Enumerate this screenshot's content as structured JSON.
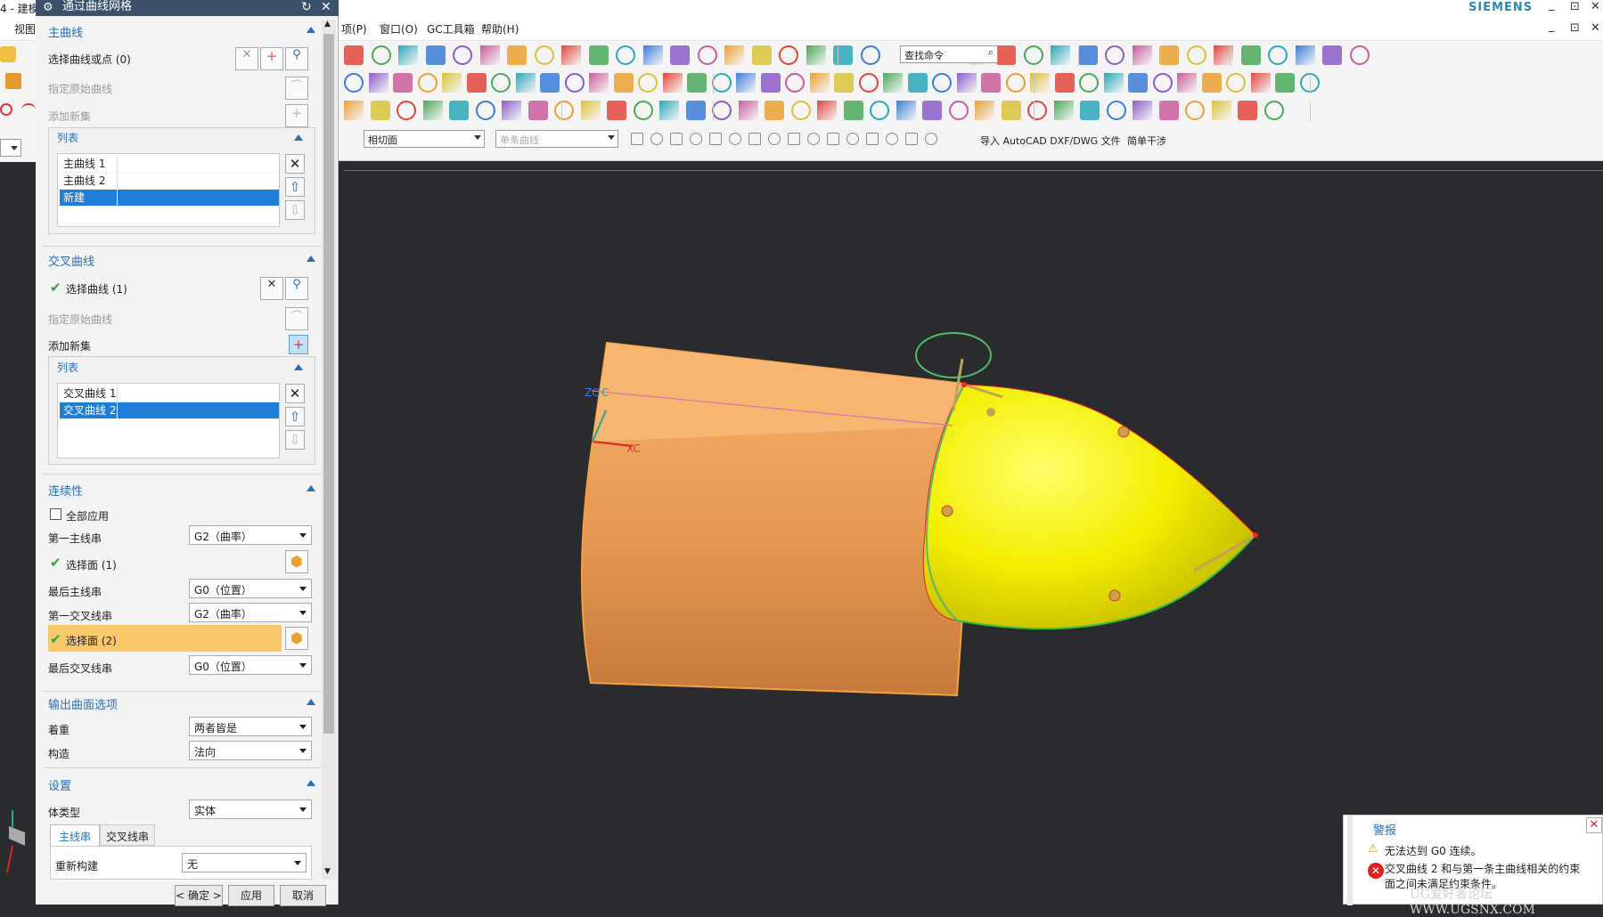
{
  "app": {
    "title_fragment": "4 - 建模",
    "brand": "SIEMENS",
    "menus": [
      "视图",
      "项(P)",
      "窗口(O)",
      "GC工具箱",
      "帮助(H)"
    ],
    "window_controls": [
      "_",
      "⊡",
      "✕"
    ]
  },
  "dialog": {
    "title": "通过曲线网格",
    "primary": {
      "header": "主曲线",
      "select_label": "选择曲线或点 (0)",
      "specify_origin": "指定原始曲线",
      "add_new_set": "添加新集",
      "list_header": "列表",
      "items": [
        "主曲线 1",
        "主曲线 2",
        "新建"
      ]
    },
    "cross": {
      "header": "交叉曲线",
      "select_label": "选择曲线 (1)",
      "specify_origin": "指定原始曲线",
      "add_new_set": "添加新集",
      "list_header": "列表",
      "items": [
        "交叉曲线 1",
        "交叉曲线 2"
      ]
    },
    "continuity": {
      "header": "连续性",
      "apply_all": "全部应用",
      "first_primary": "第一主线串",
      "first_primary_val": "G2（曲率）",
      "select_face_1": "选择面 (1)",
      "last_primary": "最后主线串",
      "last_primary_val": "G0（位置）",
      "first_cross": "第一交叉线串",
      "first_cross_val": "G2（曲率）",
      "select_face_2": "选择面 (2)",
      "last_cross": "最后交叉线串",
      "last_cross_val": "G0（位置）"
    },
    "output": {
      "header": "输出曲面选项",
      "emphasis": "着重",
      "emphasis_val": "两者皆是",
      "construction": "构造",
      "construction_val": "法向"
    },
    "settings": {
      "header": "设置",
      "body_type": "体类型",
      "body_type_val": "实体",
      "tab_primary": "主线串",
      "tab_cross": "交叉线串",
      "rebuild": "重新构建",
      "rebuild_val": "无"
    },
    "buttons": {
      "ok": "< 确定 >",
      "apply": "应用",
      "cancel": "取消"
    }
  },
  "toolbar": {
    "search_placeholder": "查找命令",
    "snap_combo": "相切面",
    "curve_combo": "单条曲线",
    "import_label": "导入 AutoCAD DXF/DWG 文件",
    "simple_label": "简单干涉"
  },
  "viewport": {
    "axis_zc": "ZC",
    "axis_xc": "XC",
    "axis_yc": "C"
  },
  "alert": {
    "title": "警报",
    "msg1": "无法达到 G0 连续。",
    "msg2": "交叉曲线 2 和与第一条主曲线相关的约束面之间未满足约束条件。"
  },
  "watermark": "UG爱好者论坛 WWW.UGSNX.COM",
  "colors": {
    "accent": "#2a6fb3",
    "selection": "#1f7fd8",
    "orange_surface": "#f2a45a",
    "yellow_surface": "#f8f200"
  }
}
